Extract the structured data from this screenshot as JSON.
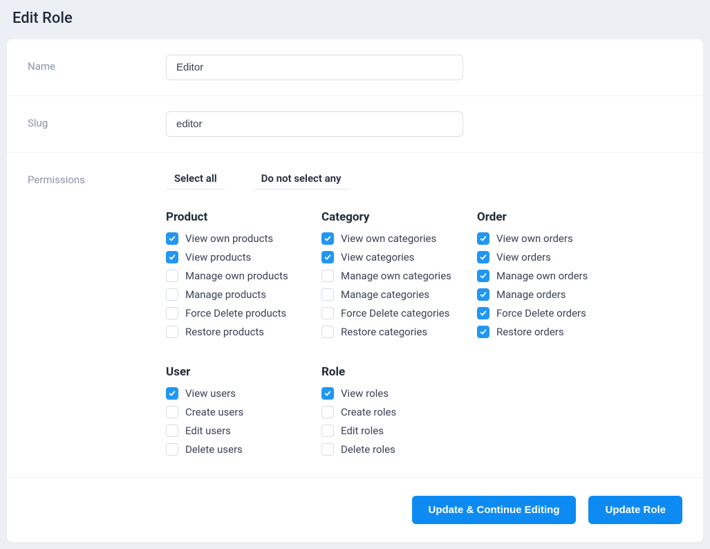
{
  "page_title": "Edit Role",
  "form": {
    "name_label": "Name",
    "name_value": "Editor",
    "slug_label": "Slug",
    "slug_value": "editor",
    "permissions_label": "Permissions"
  },
  "permissions_toolbar": {
    "select_all": "Select all",
    "deselect_all": "Do not select any"
  },
  "permission_groups": [
    {
      "title": "Product",
      "items": [
        {
          "label": "View own products",
          "checked": true
        },
        {
          "label": "View products",
          "checked": true
        },
        {
          "label": "Manage own products",
          "checked": false
        },
        {
          "label": "Manage products",
          "checked": false
        },
        {
          "label": "Force Delete products",
          "checked": false
        },
        {
          "label": "Restore products",
          "checked": false
        }
      ]
    },
    {
      "title": "Category",
      "items": [
        {
          "label": "View own categories",
          "checked": true
        },
        {
          "label": "View categories",
          "checked": true
        },
        {
          "label": "Manage own categories",
          "checked": false
        },
        {
          "label": "Manage categories",
          "checked": false
        },
        {
          "label": "Force Delete categories",
          "checked": false
        },
        {
          "label": "Restore categories",
          "checked": false
        }
      ]
    },
    {
      "title": "Order",
      "items": [
        {
          "label": "View own orders",
          "checked": true
        },
        {
          "label": "View orders",
          "checked": true
        },
        {
          "label": "Manage own orders",
          "checked": true
        },
        {
          "label": "Manage orders",
          "checked": true
        },
        {
          "label": "Force Delete orders",
          "checked": true
        },
        {
          "label": "Restore orders",
          "checked": true
        }
      ]
    },
    {
      "title": "User",
      "items": [
        {
          "label": "View users",
          "checked": true
        },
        {
          "label": "Create users",
          "checked": false
        },
        {
          "label": "Edit users",
          "checked": false
        },
        {
          "label": "Delete users",
          "checked": false
        }
      ]
    },
    {
      "title": "Role",
      "items": [
        {
          "label": "View roles",
          "checked": true
        },
        {
          "label": "Create roles",
          "checked": false
        },
        {
          "label": "Edit roles",
          "checked": false
        },
        {
          "label": "Delete roles",
          "checked": false
        }
      ]
    }
  ],
  "actions": {
    "update_continue": "Update & Continue Editing",
    "update_role": "Update Role"
  }
}
